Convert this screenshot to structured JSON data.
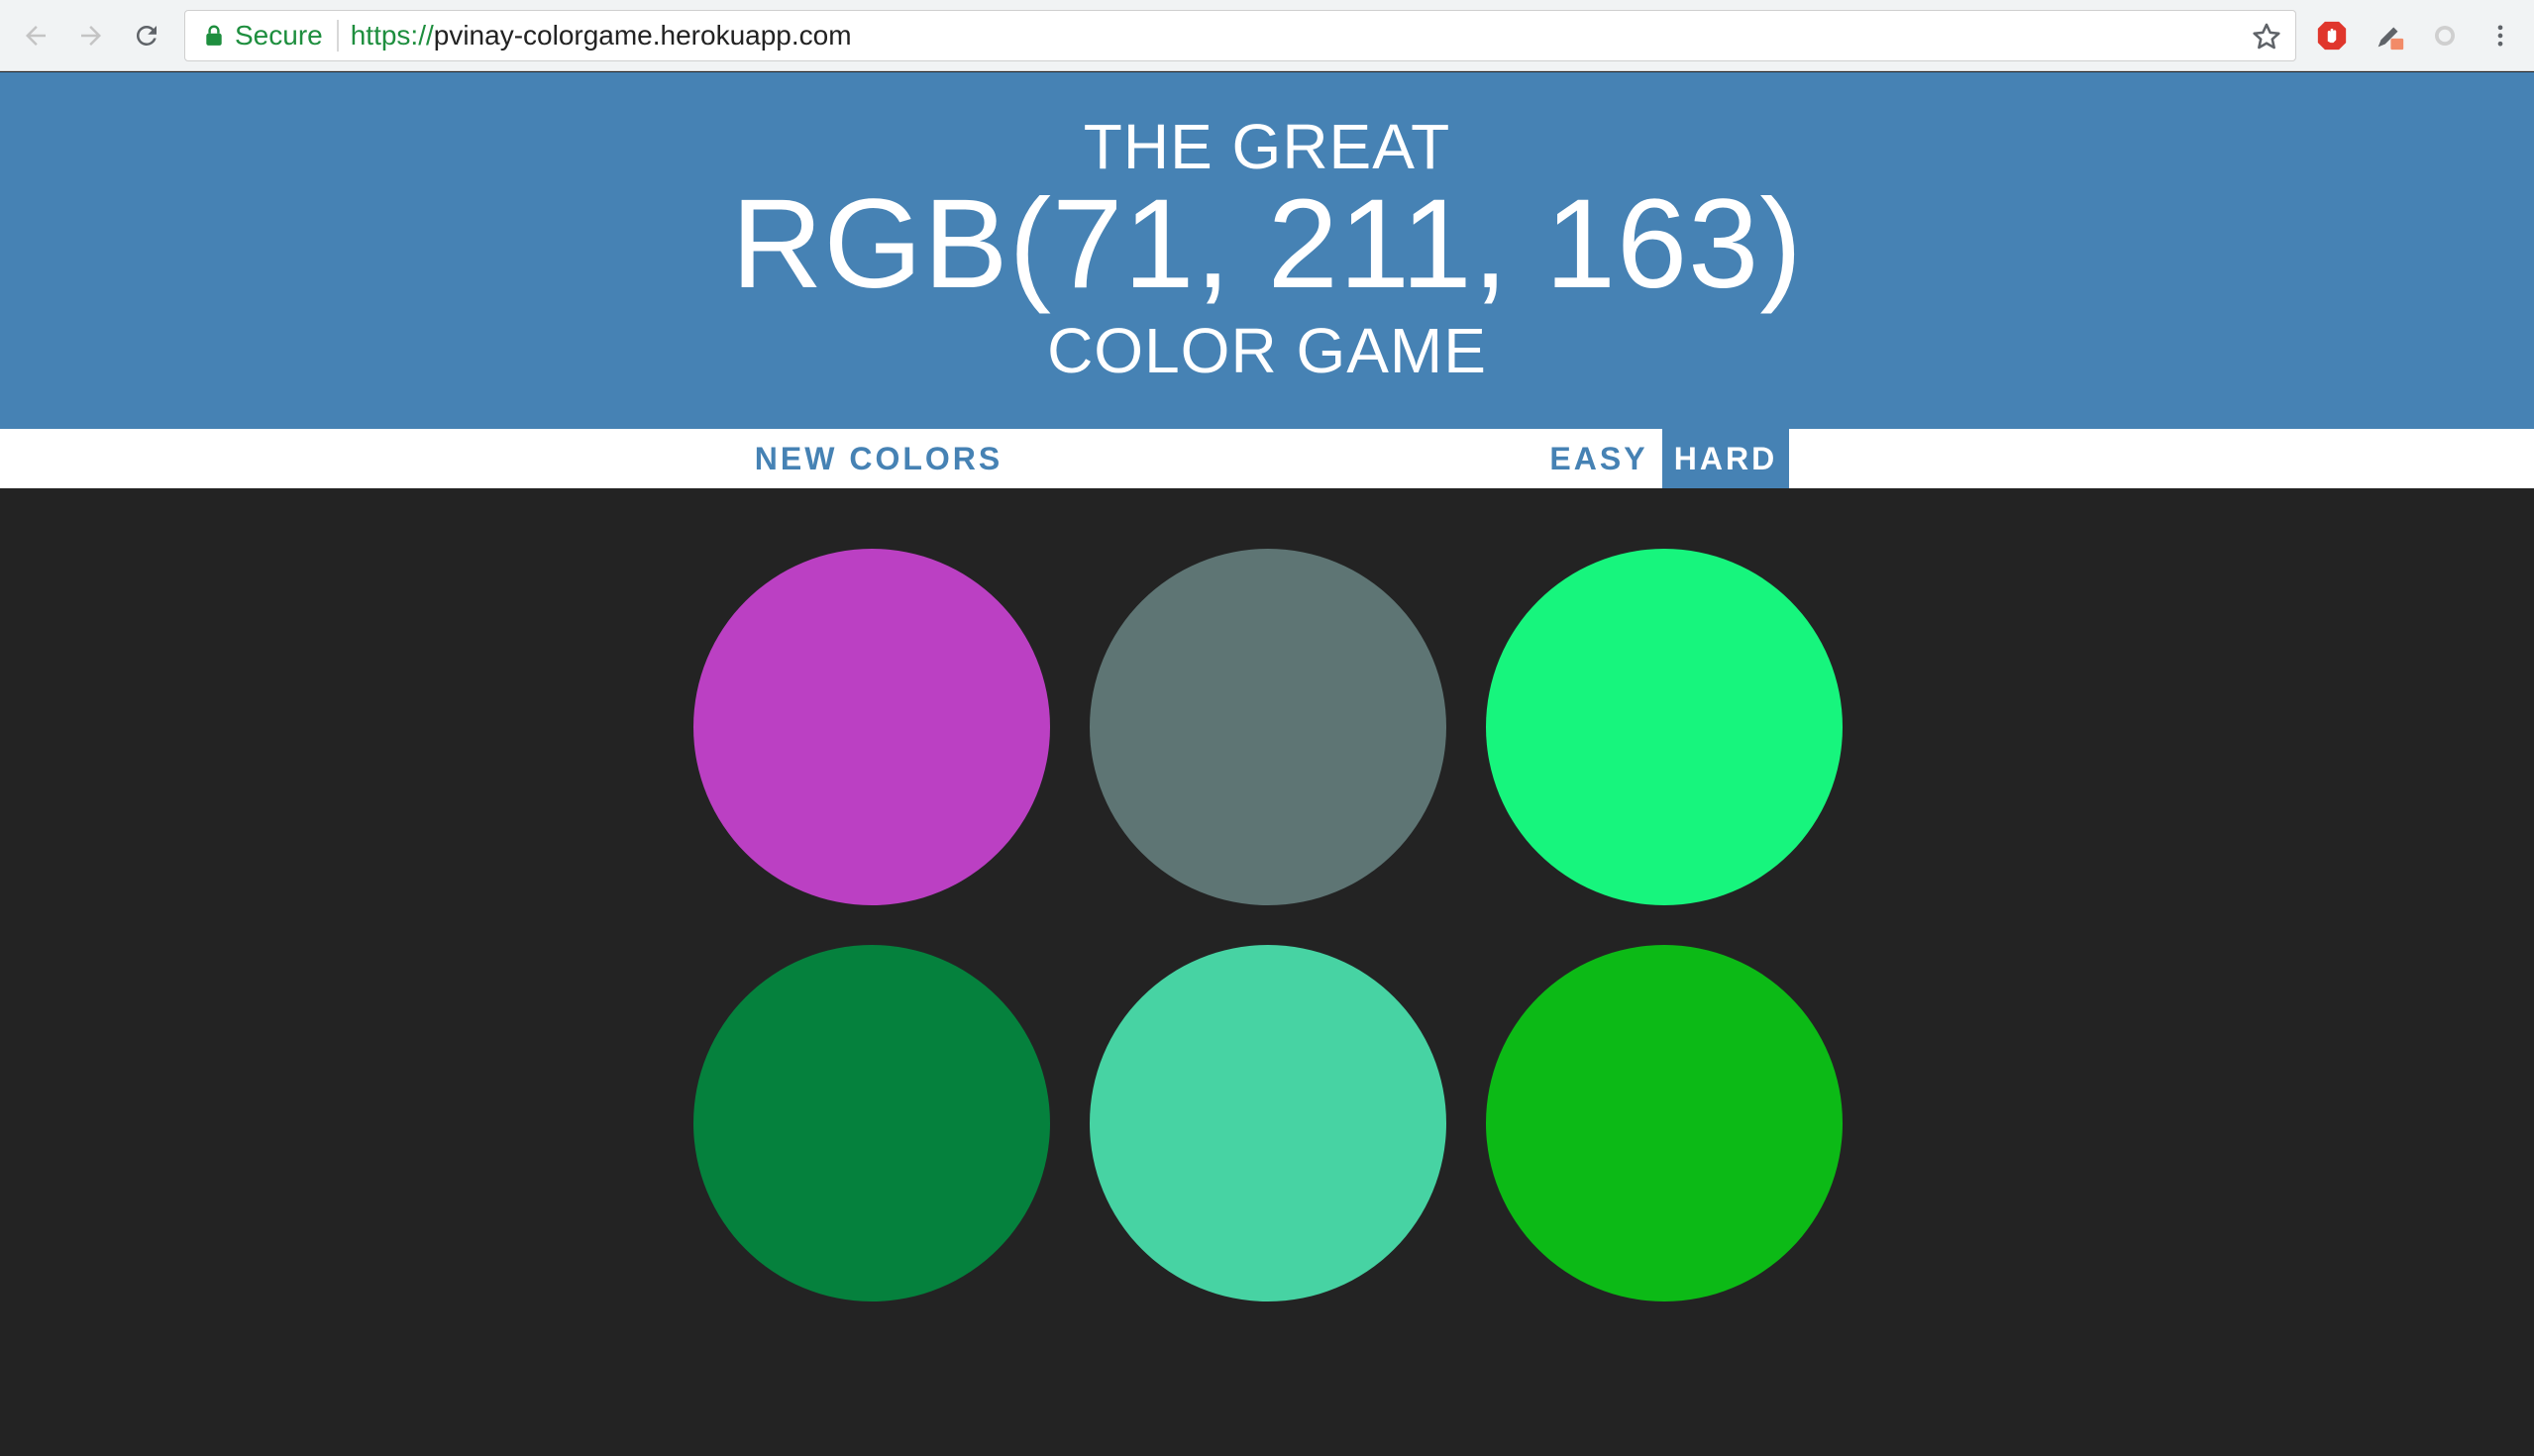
{
  "browser": {
    "secure_label": "Secure",
    "url_scheme": "https://",
    "url_host": "pvinay-colorgame.herokuapp.com"
  },
  "header": {
    "line1": "THE GREAT",
    "rgb": "RGB(71, 211, 163)",
    "line3": "COLOR GAME",
    "background": "#4682b4"
  },
  "stripe": {
    "new_colors": "NEW COLORS",
    "easy": "EASY",
    "hard": "HARD",
    "selected_mode": "HARD"
  },
  "squares": [
    {
      "color": "#bb40c3"
    },
    {
      "color": "#5e7574"
    },
    {
      "color": "#17f57d"
    },
    {
      "color": "#05813d"
    },
    {
      "color": "#47d3a3"
    },
    {
      "color": "#0cba16"
    }
  ],
  "icons": {
    "back": "arrow-left-icon",
    "forward": "arrow-right-icon",
    "reload": "reload-icon",
    "lock": "lock-icon",
    "bookmark": "star-icon",
    "menu": "kebab-menu-icon"
  }
}
